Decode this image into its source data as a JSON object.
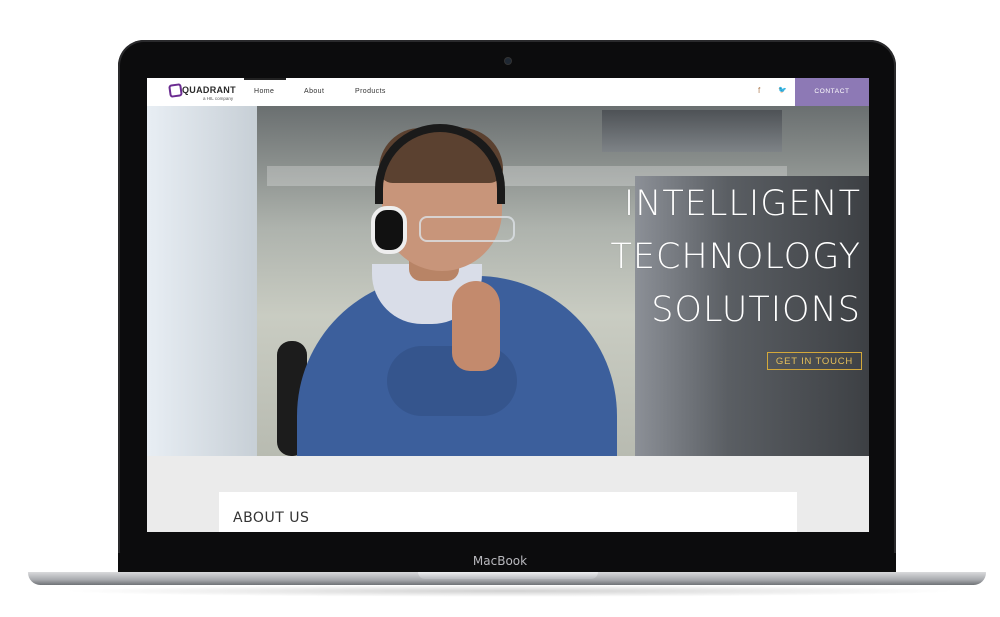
{
  "device": {
    "label": "MacBook"
  },
  "nav": {
    "logo_text": "QUADRANT",
    "logo_sub": "a HIL company",
    "items": [
      {
        "label": "Home",
        "active": true
      },
      {
        "label": "About",
        "active": false
      },
      {
        "label": "Products",
        "active": false
      }
    ],
    "social": [
      {
        "icon": "facebook-icon",
        "glyph": "f"
      },
      {
        "icon": "twitter-icon",
        "glyph": "🐦"
      }
    ],
    "contact_label": "CONTACT"
  },
  "hero": {
    "lines": [
      "INTELLIGENT",
      "TECHNOLOGY",
      "SOLUTIONS"
    ],
    "cta_label": "GET IN TOUCH"
  },
  "about": {
    "title": "ABOUT US"
  },
  "colors": {
    "brand_purple": "#6b2c91",
    "contact_bg": "#8d79b5",
    "cta_gold": "#d4a83a",
    "social": "#b07f56"
  }
}
